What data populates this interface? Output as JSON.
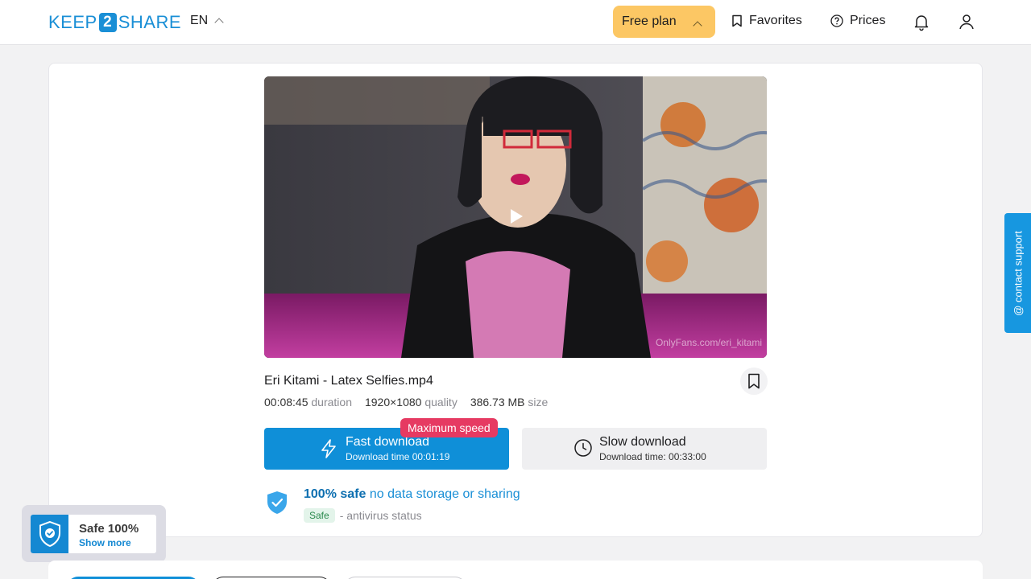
{
  "header": {
    "logo_left": "KEEP",
    "logo_mid": "2",
    "logo_right": "SHARE",
    "language": "EN",
    "plan_label": "Free plan",
    "favorites_label": "Favorites",
    "prices_label": "Prices"
  },
  "file": {
    "name": "Eri Kitami - Latex Selfies.mp4",
    "duration": "00:08:45",
    "duration_label": "duration",
    "resolution": "1920×1080",
    "resolution_label": "quality",
    "size": "386.73 MB",
    "size_label": "size",
    "watermark": "OnlyFans.com/eri_kitami"
  },
  "download": {
    "fast_label": "Fast download",
    "fast_time": "Download time 00:01:19",
    "badge": "Maximum speed",
    "slow_label": "Slow download",
    "slow_time": "Download time: 00:33:00"
  },
  "safety": {
    "bold": "100% safe",
    "rest": "no data storage or sharing",
    "status_pill": "Safe",
    "status_text": "- antivirus status"
  },
  "floating_badge": {
    "title": "Safe 100%",
    "link": "Show more"
  },
  "contact_support": "@ contact support",
  "colors": {
    "brand": "#1a8fd6",
    "plan": "#fcc764",
    "fast_button": "#0f8fd8",
    "max_speed_badge": "#e63a62"
  },
  "icons": [
    "bookmark-icon",
    "question-circle-icon",
    "bell-icon",
    "user-icon",
    "play-icon",
    "lightning-icon",
    "clock-icon",
    "shield-check-icon"
  ]
}
